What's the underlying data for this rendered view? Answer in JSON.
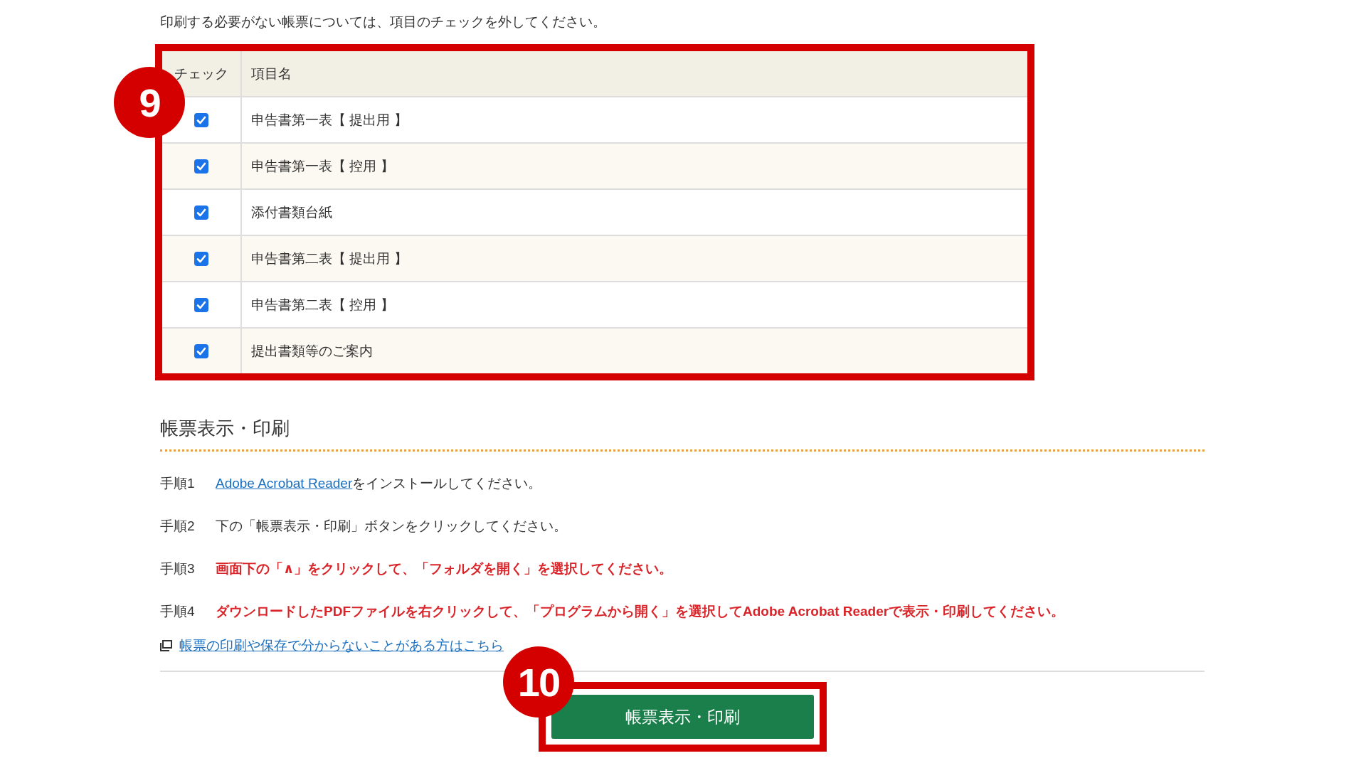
{
  "intro": "印刷する必要がない帳票については、項目のチェックを外してください。",
  "form_table": {
    "callout": "9",
    "columns": [
      "チェック",
      "項目名"
    ],
    "rows": [
      {
        "name": "申告書第一表【 提出用 】",
        "checked": true
      },
      {
        "name": "申告書第一表【 控用 】",
        "checked": true
      },
      {
        "name": "添付書類台紙",
        "checked": true
      },
      {
        "name": "申告書第二表【 提出用 】",
        "checked": true
      },
      {
        "name": "申告書第二表【 控用 】",
        "checked": true
      },
      {
        "name": "提出書類等のご案内",
        "checked": true
      }
    ]
  },
  "section": {
    "title": "帳票表示・印刷",
    "steps": [
      {
        "label": "手順1",
        "kind": "link",
        "link": "Adobe Acrobat Reader",
        "text": "をインストールしてください。"
      },
      {
        "label": "手順2",
        "kind": "plain",
        "text": "下の「帳票表示・印刷」ボタンをクリックしてください。"
      },
      {
        "label": "手順3",
        "kind": "alert",
        "text": "画面下の「∧」をクリックして、「フォルダを開く」を選択してください。"
      },
      {
        "label": "手順4",
        "kind": "alert",
        "text": "ダウンロードしたPDFファイルを右クリックして、「プログラムから開く」を選択してAdobe Acrobat Readerで表示・印刷してください。"
      }
    ],
    "help_link": "帳票の印刷や保存で分からないことがある方はこちら"
  },
  "print_button": {
    "callout": "10",
    "label": "帳票表示・印刷"
  }
}
